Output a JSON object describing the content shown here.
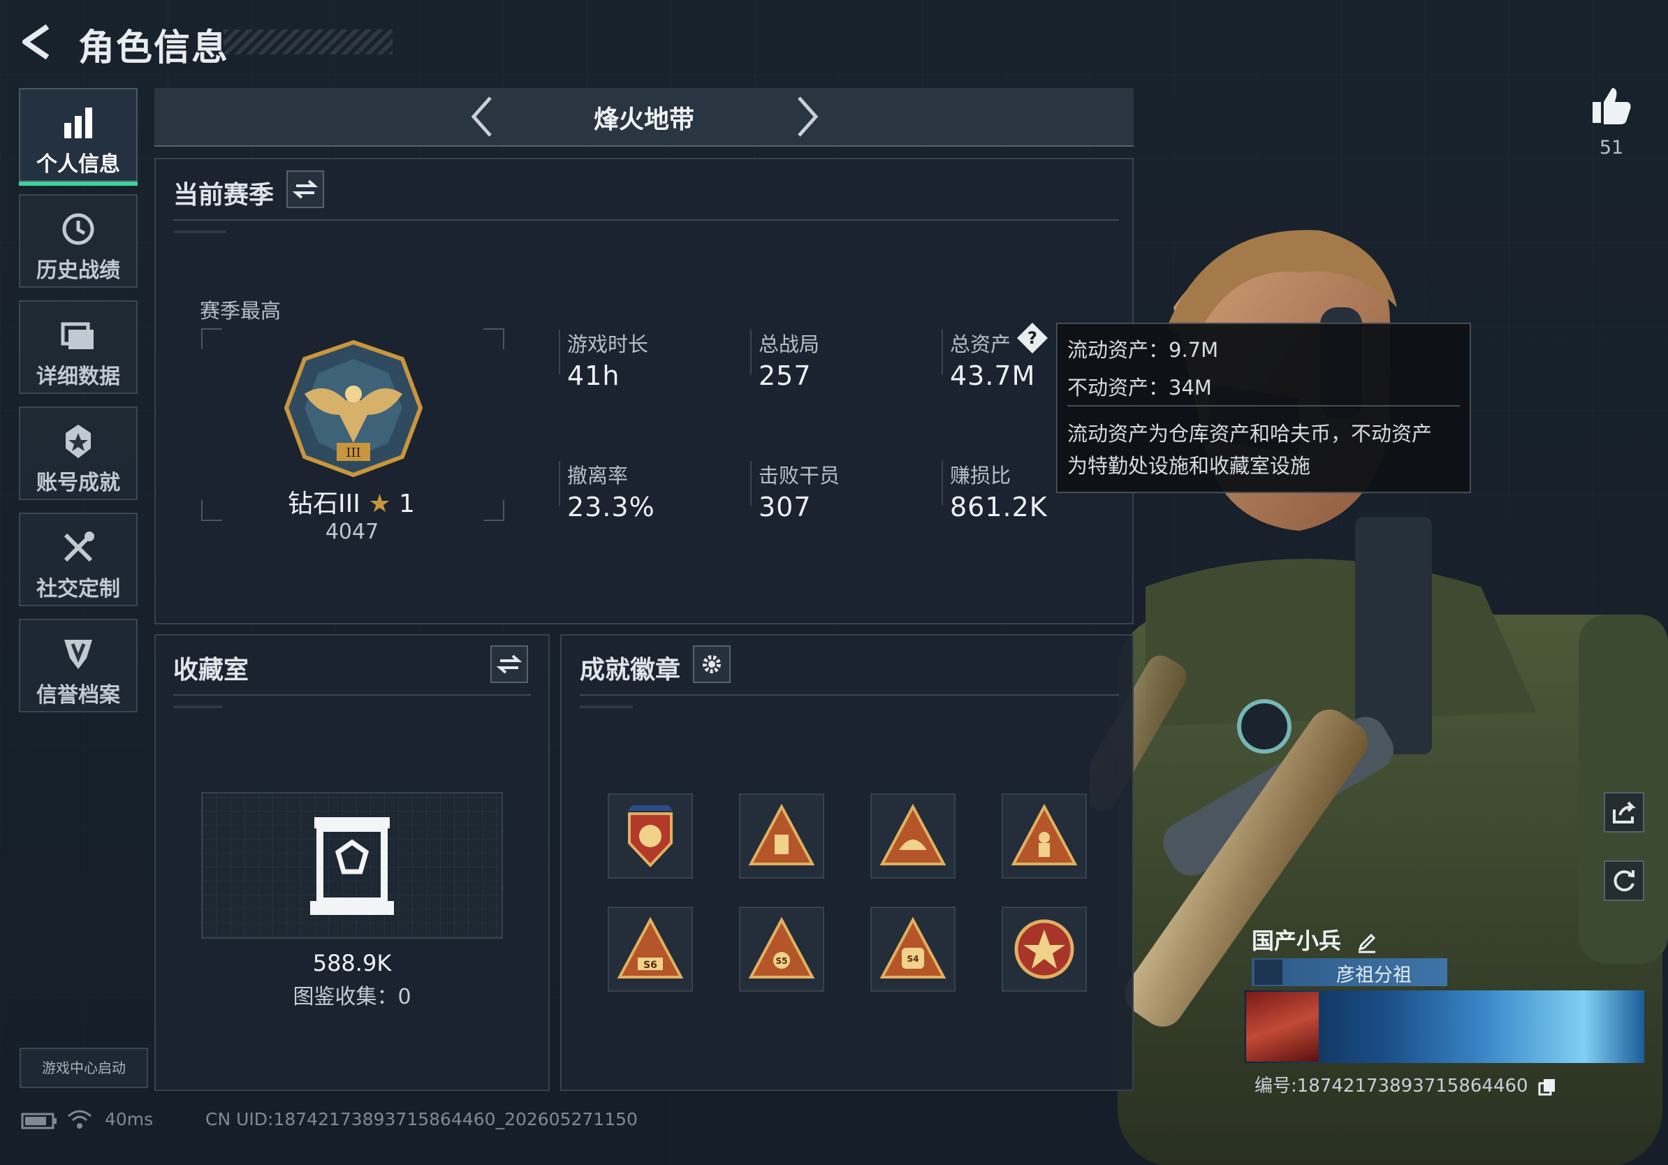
{
  "header": {
    "title": "角色信息"
  },
  "sidebar": {
    "items": [
      {
        "label": "个人信息",
        "icon": "bar-chart-icon",
        "active": true
      },
      {
        "label": "历史战绩",
        "icon": "history-clock-icon",
        "active": false
      },
      {
        "label": "详细数据",
        "icon": "folder-icon",
        "active": false
      },
      {
        "label": "账号成就",
        "icon": "achievement-star-icon",
        "active": false
      },
      {
        "label": "社交定制",
        "icon": "tools-icon",
        "active": false
      },
      {
        "label": "信誉档案",
        "icon": "credit-shield-icon",
        "active": false
      }
    ],
    "game_center_label": "游戏中心启动"
  },
  "mode": {
    "title": "烽火地带"
  },
  "season": {
    "title": "当前赛季",
    "best_label": "赛季最高",
    "rank_name": "钻石III",
    "rank_stars": "1",
    "rank_points": "4047",
    "stats": [
      {
        "label": "游戏时长",
        "value": "41h"
      },
      {
        "label": "总战局",
        "value": "257"
      },
      {
        "label": "总资产",
        "value": "43.7M"
      },
      {
        "label": "撤离率",
        "value": "23.3%"
      },
      {
        "label": "击败干员",
        "value": "307"
      },
      {
        "label": "赚损比",
        "value": "861.2K"
      }
    ]
  },
  "tooltip": {
    "liquid": "流动资产：9.7M",
    "fixed": "不动资产：34M",
    "desc1": "流动资产为仓库资产和哈夫币，不动资产",
    "desc2": "为特勤处设施和收藏室设施"
  },
  "collection": {
    "title": "收藏室",
    "value": "588.9K",
    "catalog": "图鉴收集：0"
  },
  "badges": {
    "title": "成就徽章",
    "items": [
      "badge-1",
      "badge-2",
      "badge-3",
      "badge-4",
      "badge-s6",
      "badge-s5",
      "badge-s4",
      "badge-8"
    ]
  },
  "player": {
    "likes": "51",
    "name": "国产小兵",
    "group": "彦祖分祖",
    "id": "编号:1874217389371586446​0"
  },
  "status": {
    "ping": "40ms",
    "uid": "CN UID:18742173893715864460_202605271150"
  },
  "colors": {
    "accent": "#3dd49a",
    "gold": "#c8963c",
    "bg": "#141c26"
  }
}
